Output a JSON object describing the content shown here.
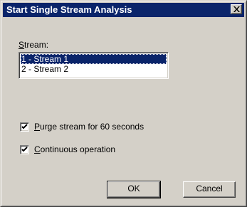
{
  "window": {
    "title": "Start Single Stream Analysis",
    "close_glyph": "close-icon"
  },
  "stream": {
    "label_mnemonic": "S",
    "label_rest": "tream:",
    "items": [
      {
        "label": "1 - Stream 1",
        "selected": true
      },
      {
        "label": "2 - Stream 2",
        "selected": false
      }
    ]
  },
  "options": {
    "purge": {
      "mnemonic": "P",
      "rest": "urge stream for 60 seconds",
      "checked": true
    },
    "continuous": {
      "mnemonic": "C",
      "rest": "ontinuous operation",
      "checked": true
    }
  },
  "buttons": {
    "ok": "OK",
    "cancel": "Cancel"
  },
  "colors": {
    "titlebar": "#0a246a",
    "face": "#d4d0c8",
    "selection": "#0a246a"
  }
}
